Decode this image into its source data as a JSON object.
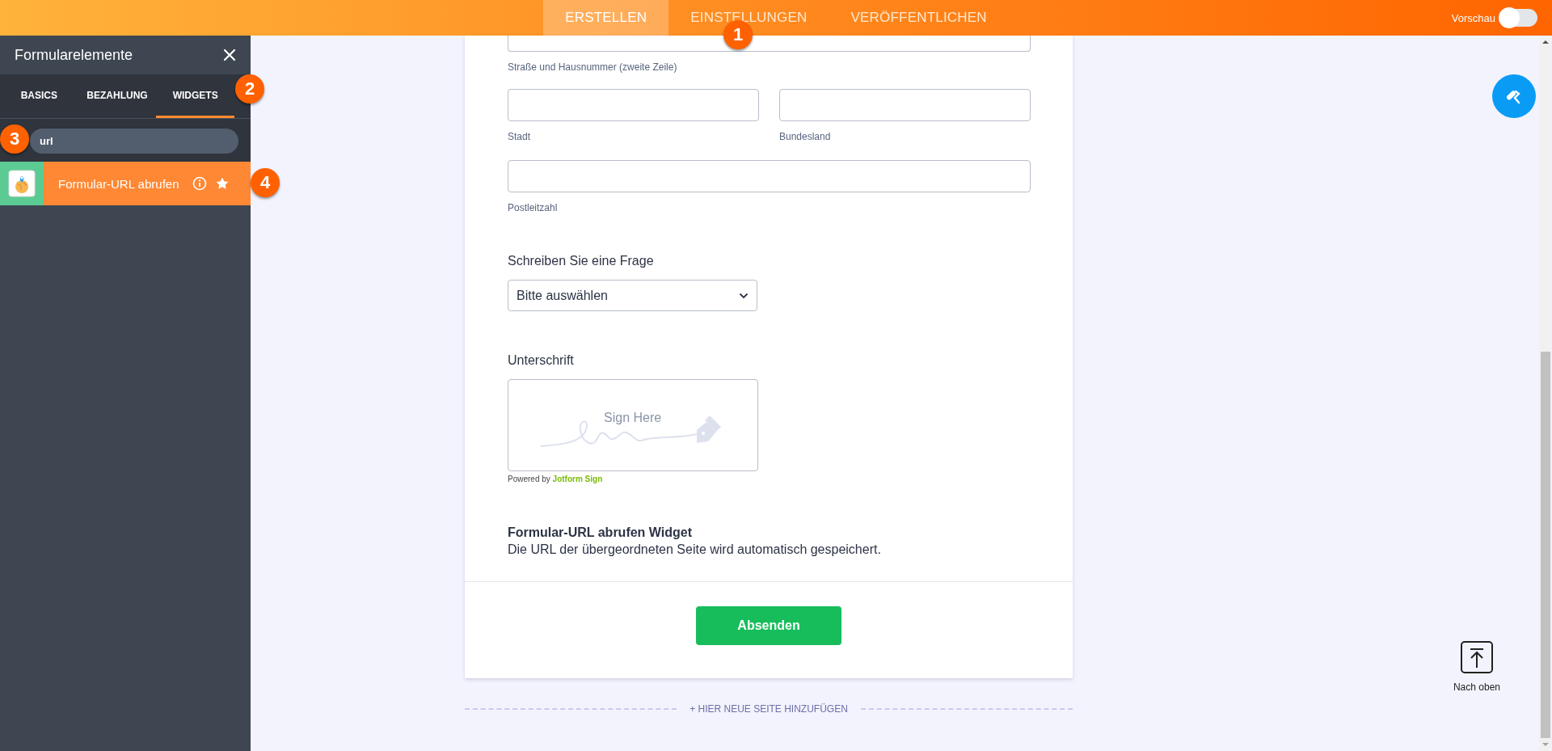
{
  "top_bar": {
    "tabs": [
      {
        "label": "ERSTELLEN",
        "selected": true
      },
      {
        "label": "EINSTELLUNGEN",
        "selected": false
      },
      {
        "label": "VERÖFFENTLICHEN",
        "selected": false
      }
    ],
    "preview": {
      "label": "Vorschau",
      "on": false
    }
  },
  "sidebar": {
    "title": "Formularelemente",
    "tabs": [
      {
        "label": "BASICS",
        "selected": false
      },
      {
        "label": "BEZAHLUNG",
        "selected": false
      },
      {
        "label": "WIDGETS",
        "selected": true
      }
    ],
    "search": {
      "value": "url"
    },
    "results": [
      {
        "label": "Formular-URL abrufen"
      }
    ]
  },
  "annotations": [
    "1",
    "2",
    "3",
    "4"
  ],
  "form": {
    "address": {
      "line2_label": "Straße und Hausnummer (zweite Zeile)",
      "city_label": "Stadt",
      "state_label": "Bundesland",
      "zip_label": "Postleitzahl"
    },
    "question": {
      "label": "Schreiben Sie eine Frage",
      "value": "Bitte auswählen"
    },
    "signature": {
      "label": "Unterschrift",
      "placeholder": "Sign Here",
      "powered_by": "Powered by",
      "brand": "Jotform Sign"
    },
    "widget": {
      "title": "Formular-URL abrufen Widget",
      "description": "Die URL der übergeordneten Seite wird automatisch gespeichert."
    },
    "submit": "Absenden"
  },
  "add_page": "+ HIER NEUE SEITE HINZUFÜGEN",
  "back_to_top": "Nach oben"
}
